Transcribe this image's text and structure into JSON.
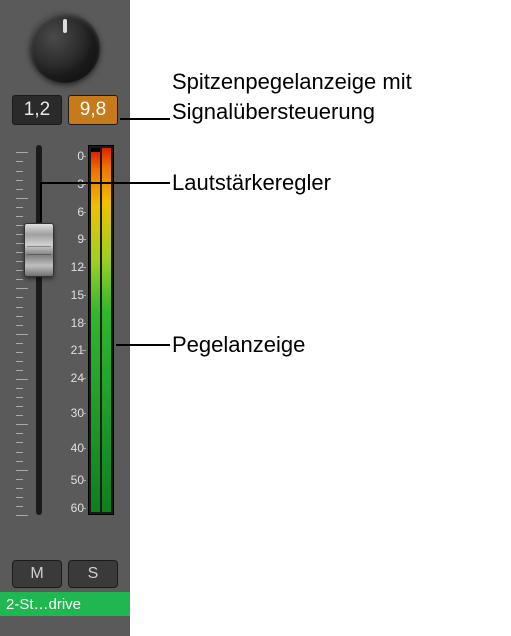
{
  "peak": {
    "left": "1,2",
    "right": "9,8"
  },
  "scale_values": [
    "0",
    "3",
    "6",
    "9",
    "12",
    "15",
    "18",
    "21",
    "24",
    "30",
    "40",
    "50",
    "60"
  ],
  "scale_positions_pct": [
    3,
    10.5,
    18,
    25.5,
    33,
    40.5,
    48,
    55.5,
    63,
    72.5,
    82,
    90.5,
    98
  ],
  "meter": {
    "left_fill_pct": 99,
    "right_fill_pct": 100
  },
  "buttons": {
    "mute": "M",
    "solo": "S"
  },
  "track_name": "2-St…drive",
  "callouts": {
    "peak": "Spitzenpegelanzeige mit\nSignalübersteuerung",
    "fader": "Lautstärkeregler",
    "meter": "Pegelanzeige"
  }
}
